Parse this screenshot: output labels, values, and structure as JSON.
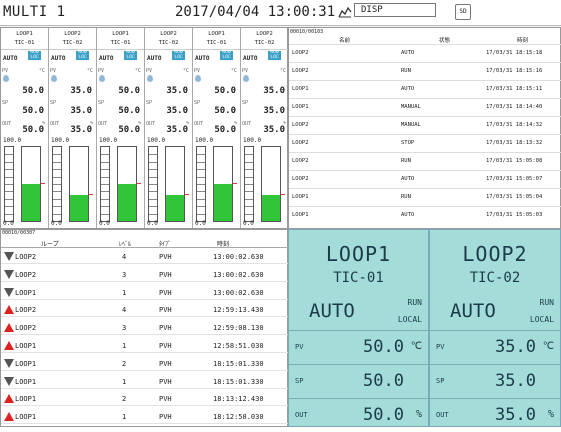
{
  "header": {
    "title": "MULTI 1",
    "datetime": "2017/04/04 13:00:31",
    "disp_label": "DISP",
    "sd_label": "SD"
  },
  "loops": [
    {
      "name": "LOOP1",
      "tag": "TIC-01",
      "mode": "AUTO",
      "run": "RUN",
      "local": "LOC",
      "pv_label": "PV",
      "unit": "°C",
      "pv": "50.0",
      "sp_label": "SP",
      "sp": "50.0",
      "out_label": "OUT",
      "out_unit": "%",
      "out": "50.0",
      "max": "100.0",
      "min": "0.0",
      "level": 0.5
    },
    {
      "name": "LOOP2",
      "tag": "TIC-02",
      "mode": "AUTO",
      "run": "RUN",
      "local": "LOC",
      "pv_label": "PV",
      "unit": "°C",
      "pv": "35.0",
      "sp_label": "SP",
      "sp": "35.0",
      "out_label": "OUT",
      "out_unit": "%",
      "out": "35.0",
      "max": "100.0",
      "min": "0.0",
      "level": 0.35
    },
    {
      "name": "LOOP1",
      "tag": "TIC-01",
      "mode": "AUTO",
      "run": "RUN",
      "local": "LOC",
      "pv_label": "PV",
      "unit": "°C",
      "pv": "50.0",
      "sp_label": "SP",
      "sp": "50.0",
      "out_label": "OUT",
      "out_unit": "%",
      "out": "50.0",
      "max": "100.0",
      "min": "0.0",
      "level": 0.5
    },
    {
      "name": "LOOP2",
      "tag": "TIC-02",
      "mode": "AUTO",
      "run": "RUN",
      "local": "LOC",
      "pv_label": "PV",
      "unit": "°C",
      "pv": "35.0",
      "sp_label": "SP",
      "sp": "35.0",
      "out_label": "OUT",
      "out_unit": "%",
      "out": "35.0",
      "max": "100.0",
      "min": "0.0",
      "level": 0.35
    },
    {
      "name": "LOOP1",
      "tag": "TIC-01",
      "mode": "AUTO",
      "run": "RUN",
      "local": "LOC",
      "pv_label": "PV",
      "unit": "°C",
      "pv": "50.0",
      "sp_label": "SP",
      "sp": "50.0",
      "out_label": "OUT",
      "out_unit": "%",
      "out": "50.0",
      "max": "100.0",
      "min": "0.0",
      "level": 0.5
    },
    {
      "name": "LOOP2",
      "tag": "TIC-02",
      "mode": "AUTO",
      "run": "RUN",
      "local": "LOC",
      "pv_label": "PV",
      "unit": "°C",
      "pv": "35.0",
      "sp_label": "SP",
      "sp": "35.0",
      "out_label": "OUT",
      "out_unit": "%",
      "out": "35.0",
      "max": "100.0",
      "min": "0.0",
      "level": 0.35
    }
  ],
  "eventlog": {
    "count": "00010/00103",
    "columns": [
      "名前",
      "状態",
      "時刻"
    ],
    "rows": [
      {
        "name": "LOOP2",
        "status": "AUTO",
        "time": "17/03/31 18:15:18"
      },
      {
        "name": "LOOP2",
        "status": "RUN",
        "time": "17/03/31 18:15:16"
      },
      {
        "name": "LOOP1",
        "status": "AUTO",
        "time": "17/03/31 18:15:11"
      },
      {
        "name": "LOOP1",
        "status": "MANUAL",
        "time": "17/03/31 18:14:40"
      },
      {
        "name": "LOOP2",
        "status": "MANUAL",
        "time": "17/03/31 18:14:32"
      },
      {
        "name": "LOOP2",
        "status": "STOP",
        "time": "17/03/31 18:13:32"
      },
      {
        "name": "LOOP2",
        "status": "RUN",
        "time": "17/03/31 15:05:08"
      },
      {
        "name": "LOOP2",
        "status": "AUTO",
        "time": "17/03/31 15:05:07"
      },
      {
        "name": "LOOP1",
        "status": "RUN",
        "time": "17/03/31 15:05:04"
      },
      {
        "name": "LOOP1",
        "status": "AUTO",
        "time": "17/03/31 15:05:03"
      }
    ]
  },
  "alarmlog": {
    "count": "00010/00307",
    "columns": [
      "ループ",
      "ﾚﾍﾞﾙ",
      "ﾀｲﾌﾟ",
      "時刻"
    ],
    "rows": [
      {
        "dir": "down",
        "loop": "LOOP2",
        "level": "4",
        "type": "PVH",
        "time": "13:00:02.630"
      },
      {
        "dir": "down",
        "loop": "LOOP2",
        "level": "3",
        "type": "PVH",
        "time": "13:00:02.630"
      },
      {
        "dir": "down",
        "loop": "LOOP1",
        "level": "1",
        "type": "PVH",
        "time": "13:00:02.630"
      },
      {
        "dir": "up",
        "loop": "LOOP2",
        "level": "4",
        "type": "PVH",
        "time": "12:59:13.430"
      },
      {
        "dir": "up",
        "loop": "LOOP2",
        "level": "3",
        "type": "PVH",
        "time": "12:59:08.130"
      },
      {
        "dir": "up",
        "loop": "LOOP1",
        "level": "1",
        "type": "PVH",
        "time": "12:58:51.030"
      },
      {
        "dir": "down",
        "loop": "LOOP1",
        "level": "2",
        "type": "PVH",
        "time": "18:15:01.330"
      },
      {
        "dir": "down",
        "loop": "LOOP1",
        "level": "1",
        "type": "PVH",
        "time": "18:15:01.330"
      },
      {
        "dir": "up",
        "loop": "LOOP1",
        "level": "2",
        "type": "PVH",
        "time": "18:13:12.430"
      },
      {
        "dir": "up",
        "loop": "LOOP1",
        "level": "1",
        "type": "PVH",
        "time": "18:12:58.030"
      }
    ]
  },
  "faceplates": [
    {
      "name": "LOOP1",
      "tag": "TIC-01",
      "mode": "AUTO",
      "run": "RUN",
      "local": "LOCAL",
      "pv_label": "PV",
      "pv": "50.0",
      "pv_unit": "℃",
      "sp_label": "SP",
      "sp": "50.0",
      "out_label": "OUT",
      "out": "50.0",
      "out_unit": "%"
    },
    {
      "name": "LOOP2",
      "tag": "TIC-02",
      "mode": "AUTO",
      "run": "RUN",
      "local": "LOCAL",
      "pv_label": "PV",
      "pv": "35.0",
      "pv_unit": "℃",
      "sp_label": "SP",
      "sp": "35.0",
      "out_label": "OUT",
      "out": "35.0",
      "out_unit": "%"
    }
  ],
  "colors": {
    "bar_fill": "#31c53a",
    "run_badge": "#3aa0c8",
    "faceplate_bg": "#a4dcd9",
    "alarm_up": "#dd2222",
    "alarm_down": "#555555"
  }
}
